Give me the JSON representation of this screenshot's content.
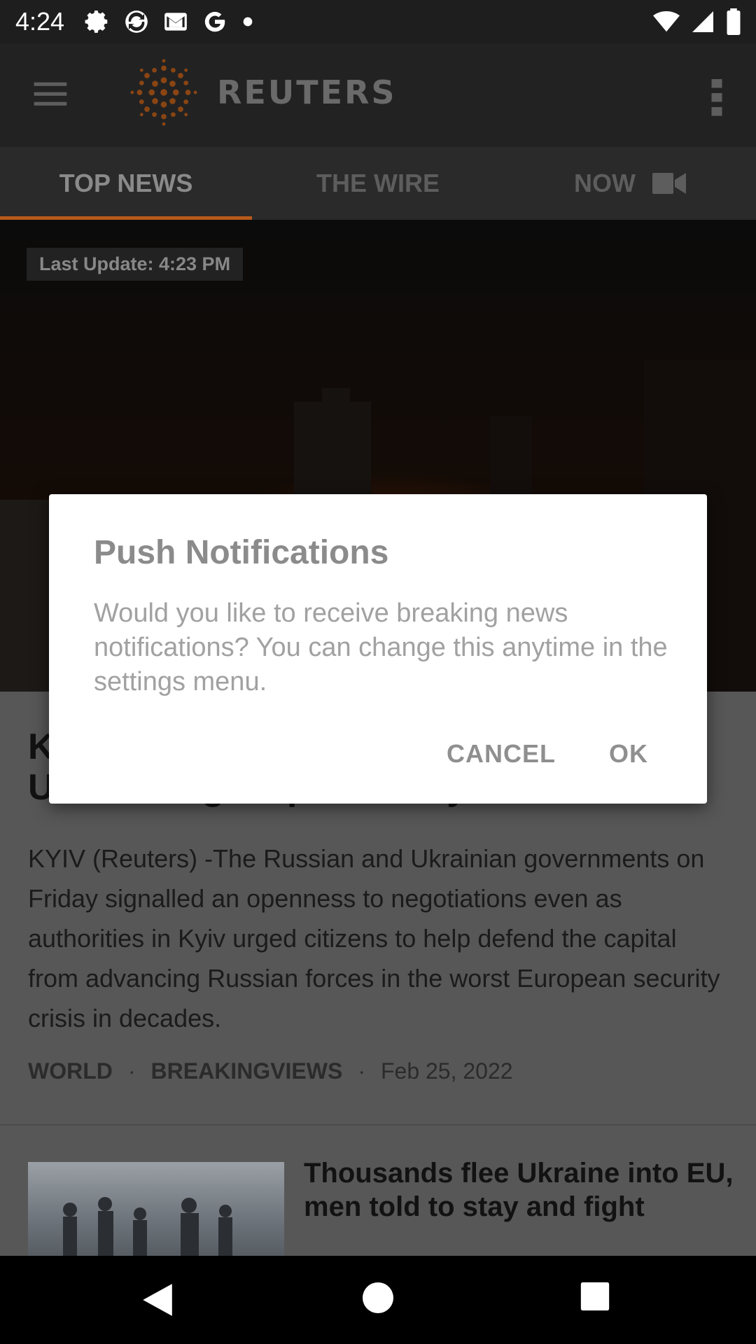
{
  "status_bar": {
    "time": "4:24"
  },
  "app_bar": {
    "brand": "REUTERS",
    "brand_color": "#b8601a"
  },
  "tabs": [
    {
      "label": "TOP NEWS",
      "active": true
    },
    {
      "label": "THE WIRE",
      "active": false
    },
    {
      "label": "NOW",
      "active": false,
      "icon": "video-icon"
    }
  ],
  "hero": {
    "last_update": "Last Update: 4:23 PM"
  },
  "article": {
    "headline": "K\nUkraine signal possibility of talks",
    "summary": "KYIV (Reuters) -The Russian and Ukrainian governments on Friday signalled an openness to negotiations even as authorities in Kyiv urged citizens to help defend the capital from advancing Russian forces in the worst European security crisis in decades.",
    "categories": [
      "WORLD",
      "BREAKINGVIEWS"
    ],
    "date": "Feb 25, 2022"
  },
  "next_story": {
    "headline": "Thousands flee Ukraine into EU, men told to stay and fight"
  },
  "dialog": {
    "title": "Push Notifications",
    "message": "Would you like to receive breaking news notifications? You can change this anytime in the settings menu.",
    "cancel_label": "CANCEL",
    "ok_label": "OK"
  }
}
